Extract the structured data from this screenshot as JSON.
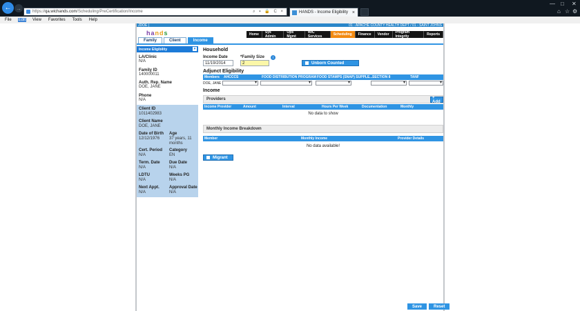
{
  "browser": {
    "url_prefix": "https://",
    "url_host": "qa.wichands.com",
    "url_path": "/Scheduling/PreCertification/Income",
    "url_controls": "⌕ ▾ 🔒 C ×",
    "tab_title": "HANDS - Income Eligibility",
    "tab_close": "×",
    "back_icon": "←",
    "forward_icon": "→",
    "min": "—",
    "max": "□",
    "close": "✕",
    "home": "⌂",
    "star": "☆",
    "gear": "⚙"
  },
  "menubar": {
    "items": [
      "File",
      "Edit",
      "View",
      "Favorites",
      "Tools",
      "Help"
    ],
    "active_index": 1
  },
  "app": {
    "user_tag": "JDOE |",
    "dept_line": "01 - APACHE COUNTY HEALTH DEPT / 01 - SAINT JOHNS",
    "logo": {
      "h": "ha",
      "d": "nd",
      "s": "s"
    },
    "topnav": [
      "Home",
      "Sys Admin",
      "Ops Mgmt",
      "WIC Services",
      "Scheduling",
      "Finance",
      "Vendor",
      "Program Integrity",
      "Reports"
    ],
    "topnav_active": "Scheduling",
    "tabs": [
      "Family",
      "Client",
      "Income"
    ],
    "tabs_active": "Income"
  },
  "left_panel": {
    "header": "Income Eligibility",
    "dropdown_icon": "▾",
    "la_clinic_label": "LA/Clinic",
    "la_clinic_value": "N/A",
    "family_id_label": "Family ID",
    "family_id_value": "140000011",
    "auth_rep_label": "Auth. Rep. Name",
    "auth_rep_value": "DOE, JANE",
    "phone_label": "Phone",
    "phone_value": "N/A",
    "client": {
      "client_id_label": "Client ID",
      "client_id_value": "1011402983",
      "client_name_label": "Client Name",
      "client_name_value": "DOE, JANE",
      "dob_label": "Date of Birth",
      "dob_value": "12/12/1976",
      "age_label": "Age",
      "age_value": "37 years, 11 months",
      "cert_label": "Cert. Period",
      "cert_value": "N/A",
      "category_label": "Category",
      "category_value": "EN",
      "term_label": "Term. Date",
      "term_value": "N/A",
      "due_label": "Due Date",
      "due_value": "N/A",
      "ldtu_label": "LDTU",
      "ldtu_value": "N/A",
      "weeks_label": "Weeks PG",
      "weeks_value": "N/A",
      "next_label": "Next Appt.",
      "next_value": "N/A",
      "approval_label": "Approval Date",
      "approval_value": "N/A"
    }
  },
  "household": {
    "title": "Household",
    "income_date_label": "Income Date",
    "income_date_value": "11/19/2014",
    "family_size_label": "*Family Size",
    "family_size_value": "2",
    "info_icon": "i",
    "unborn_button": "Unborn Counted"
  },
  "adjunct": {
    "title": "Adjunct Eligibility",
    "columns": [
      "Members",
      "AHCCCS",
      "FOOD DISTRIBUTION PROGRAM",
      "FOOD STAMPS (SNAP) SUPPLE...",
      "SECTION 8",
      "TANF"
    ],
    "member_name": "DOE, JANE"
  },
  "income": {
    "title": "Income",
    "providers_label": "Providers",
    "add_button": "+ Add",
    "columns": [
      "Income Provider",
      "Amount",
      "Interval",
      "Hours Per Week",
      "Documentation",
      "Monthly"
    ],
    "no_data": "No data to show",
    "breakdown_label": "Monthly Income Breakdown",
    "breakdown_columns": [
      "Member",
      "Monthly Income",
      "Provider Details"
    ],
    "breakdown_no_data": "No data available!",
    "migrant_button": "Migrant"
  },
  "footer": {
    "save": "Save",
    "reset": "Reset"
  }
}
